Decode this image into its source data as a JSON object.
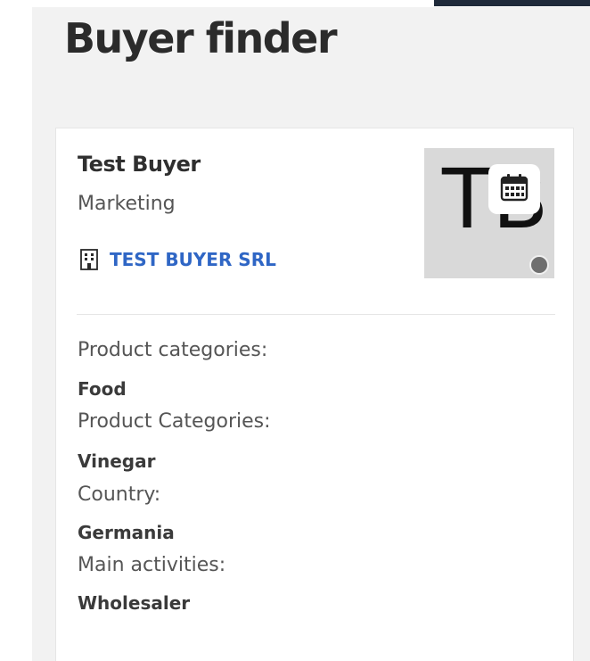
{
  "page": {
    "title": "Buyer finder"
  },
  "buyer": {
    "name": "Test Buyer",
    "role": "Marketing",
    "company": "TEST BUYER SRL",
    "avatar_initials": "TB",
    "status_color": "#6f6f6f"
  },
  "details": [
    {
      "label": "Product categories:",
      "value": "Food"
    },
    {
      "label": "Product Categories:",
      "value": "Vinegar"
    },
    {
      "label": "Country:",
      "value": "Germania"
    },
    {
      "label": "Main activities:",
      "value": "Wholesaler"
    }
  ],
  "icons": {
    "company": "building-icon",
    "schedule": "calendar-icon"
  },
  "colors": {
    "link": "#2f66c5",
    "panel_bg": "#f2f2f2",
    "top_bar": "#1f2a3a"
  }
}
